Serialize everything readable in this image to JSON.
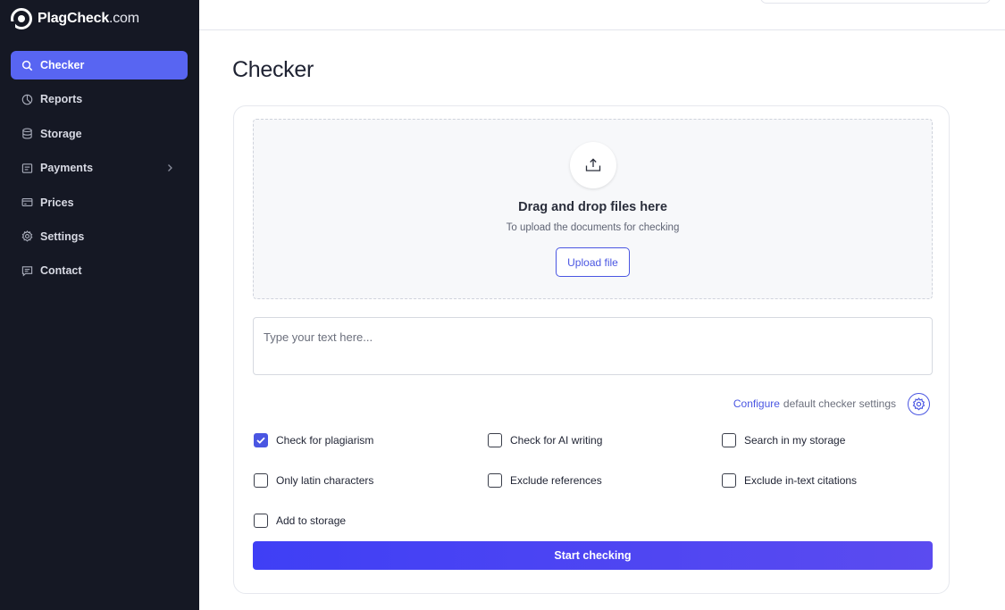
{
  "brand": {
    "name": "PlagCheck",
    "domain": ".com",
    "accent": "#5865f2",
    "sidebar_bg": "#151824"
  },
  "sidebar": {
    "items": [
      {
        "label": "Checker",
        "icon": "search-icon",
        "active": true
      },
      {
        "label": "Reports",
        "icon": "pie-chart-icon"
      },
      {
        "label": "Storage",
        "icon": "database-icon"
      },
      {
        "label": "Payments",
        "icon": "receipt-icon",
        "has_submenu": true
      },
      {
        "label": "Prices",
        "icon": "card-icon"
      },
      {
        "label": "Settings",
        "icon": "gear-icon"
      },
      {
        "label": "Contact",
        "icon": "message-icon"
      }
    ]
  },
  "main": {
    "title": "Checker",
    "dropzone": {
      "icon": "upload-icon",
      "title": "Drag and drop files here",
      "subtitle": "To upload the documents for checking",
      "button": "Upload file"
    },
    "text_input": {
      "placeholder": "Type your text here...",
      "value": ""
    },
    "config": {
      "link": "Configure",
      "text": "default checker settings",
      "icon": "gear-icon"
    },
    "options": [
      {
        "label": "Check for plagiarism",
        "checked": true
      },
      {
        "label": "Check for AI writing",
        "checked": false
      },
      {
        "label": "Search in my storage",
        "checked": false
      },
      {
        "label": "Only latin characters",
        "checked": false
      },
      {
        "label": "Exclude references",
        "checked": false
      },
      {
        "label": "Exclude in-text citations",
        "checked": false
      },
      {
        "label": "Add to storage",
        "checked": false
      }
    ],
    "submit": "Start checking"
  }
}
